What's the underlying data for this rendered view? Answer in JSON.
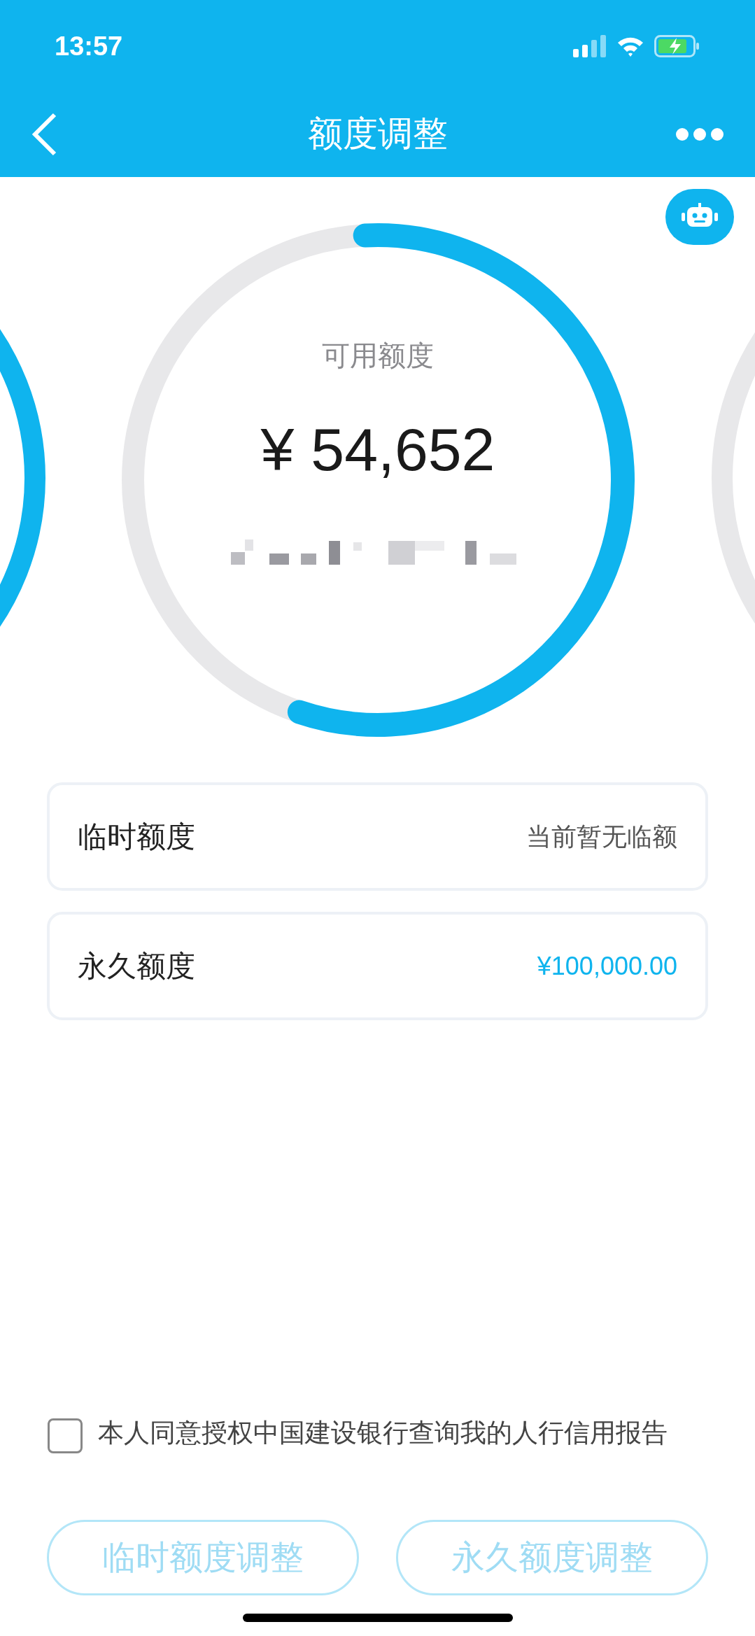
{
  "status_bar": {
    "time": "13:57"
  },
  "nav": {
    "title": "额度调整"
  },
  "ring": {
    "label": "可用额度",
    "amount": "¥ 54,652",
    "level": 0.56
  },
  "limits": [
    {
      "label": "临时额度",
      "value": "当前暂无临额",
      "highlight": false
    },
    {
      "label": "永久额度",
      "value": "¥100,000.00",
      "highlight": true
    }
  ],
  "consent": {
    "checked": false,
    "text": "本人同意授权中国建设银行查询我的人行信用报告"
  },
  "buttons": [
    {
      "label": "临时额度调整",
      "disabled": true
    },
    {
      "label": "永久额度调整",
      "disabled": true
    }
  ]
}
